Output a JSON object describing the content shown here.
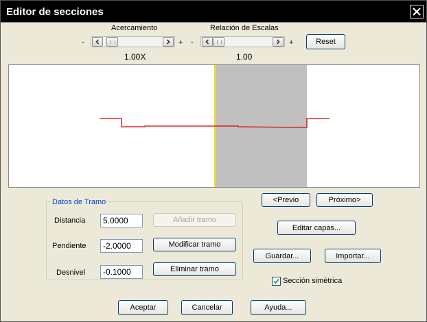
{
  "window": {
    "title": "Editor de secciones"
  },
  "zoom": {
    "label": "Acercamiento",
    "minus": "-",
    "plus": "+",
    "value": "1.00X"
  },
  "scale": {
    "label": "Relación de Escalas",
    "minus": "-",
    "plus": "+",
    "value": "1.00"
  },
  "reset_label": "Reset",
  "nav": {
    "prev_label": "<Previo",
    "next_label": "Próximo>"
  },
  "segment": {
    "group_title": "Datos de Tramo",
    "distancia_label": "Distancia",
    "distancia_value": "5.0000",
    "pendiente_label": "Pendiente",
    "pendiente_value": "-2.0000",
    "desnivel_label": "Desnivel",
    "desnivel_value": "-0.1000",
    "add_label": "Añadir tramo",
    "modify_label": "Modificar tramo",
    "delete_label": "Eliminar tramo"
  },
  "actions": {
    "edit_layers_label": "Editar capas...",
    "save_label": "Guardar...",
    "import_label": "Importar...",
    "symmetric_label": "Sección simétrica",
    "symmetric_checked": true
  },
  "footer": {
    "accept_label": "Aceptar",
    "cancel_label": "Cancelar",
    "help_label": "Ayuda..."
  },
  "colors": {
    "title_bar": "#000000",
    "section_line": "#dd0000",
    "centerline": "#f0e020",
    "shaded_band": "#c0c0c0",
    "group_title": "#0046d5"
  },
  "icons": {
    "close": "close-icon",
    "arrow_left": "chevron-left-icon",
    "arrow_right": "chevron-right-icon",
    "check": "checkmark-icon"
  }
}
